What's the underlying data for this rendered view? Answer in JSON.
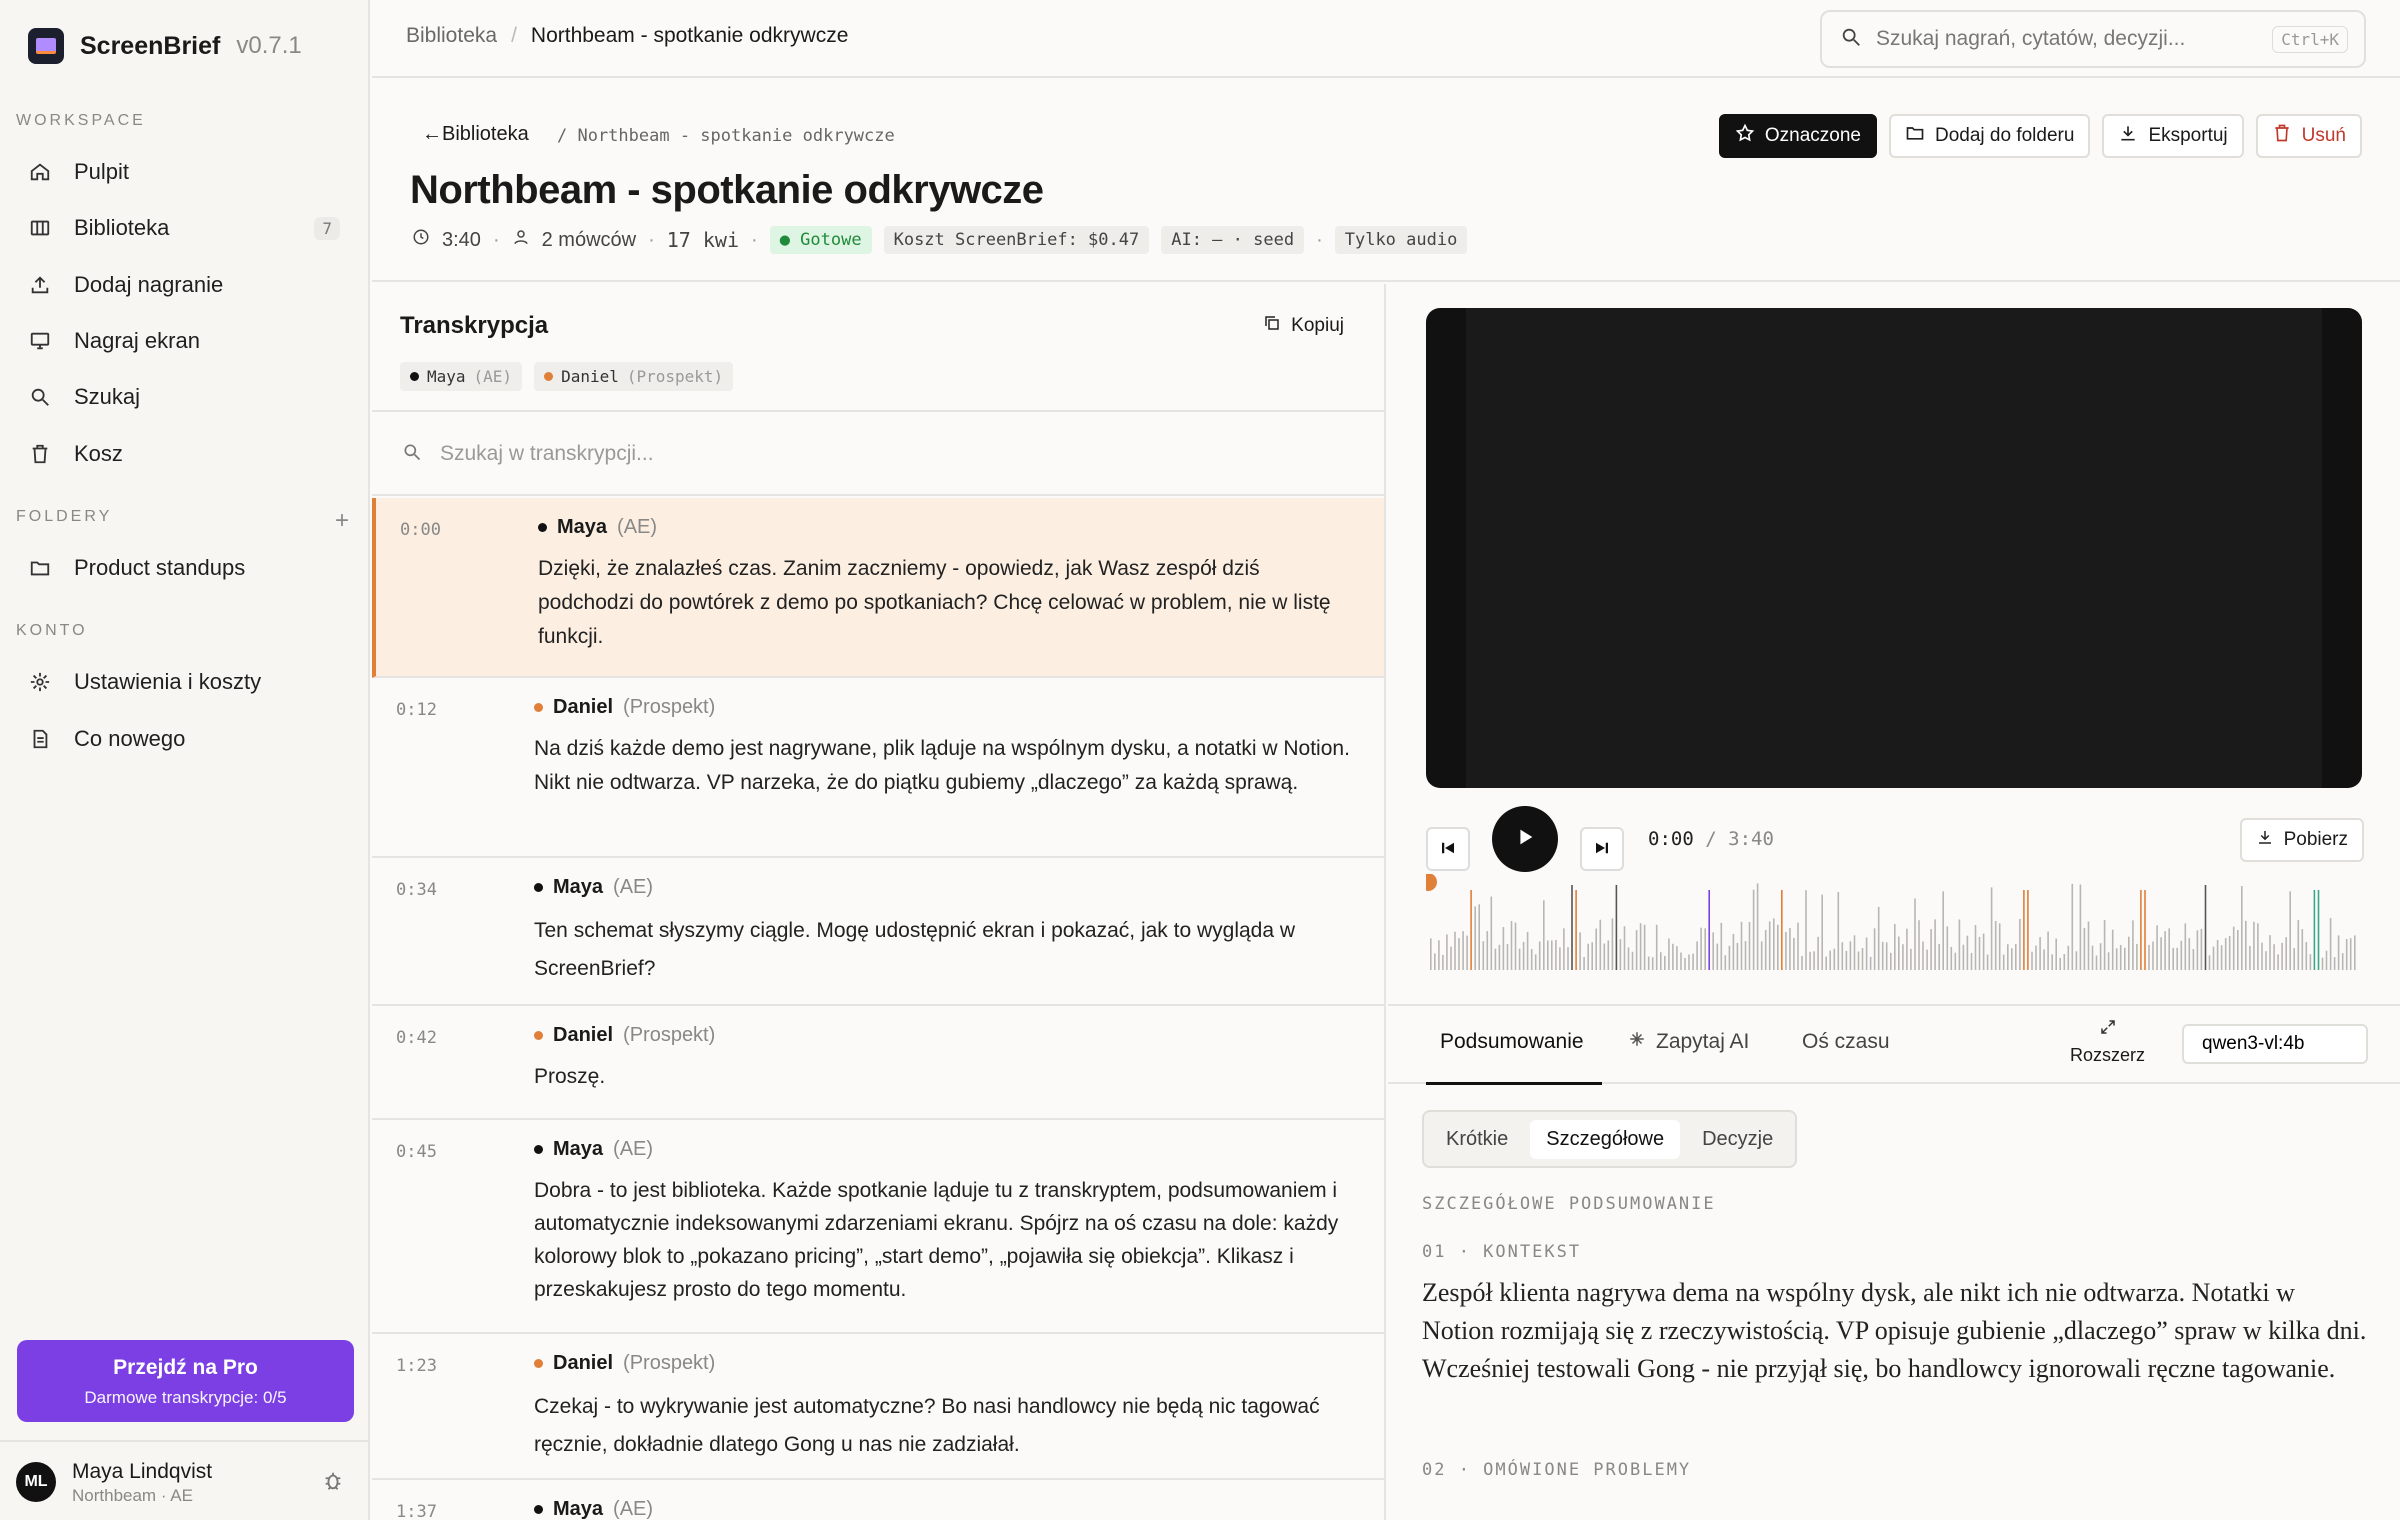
{
  "app": {
    "name": "ScreenBrief",
    "version": "v0.7.1"
  },
  "sidebar": {
    "workspace_label": "WORKSPACE",
    "workspace_items": [
      {
        "label": "Pulpit",
        "icon": "home-icon"
      },
      {
        "label": "Biblioteka",
        "icon": "library-icon",
        "badge": "7"
      },
      {
        "label": "Dodaj nagranie",
        "icon": "upload-icon"
      },
      {
        "label": "Nagraj ekran",
        "icon": "monitor-icon"
      },
      {
        "label": "Szukaj",
        "icon": "search-icon"
      },
      {
        "label": "Kosz",
        "icon": "trash-icon"
      }
    ],
    "folders_label": "FOLDERY",
    "folders": [
      {
        "label": "Product standups",
        "icon": "folder-icon"
      }
    ],
    "account_label": "KONTO",
    "account_items": [
      {
        "label": "Ustawienia i koszty",
        "icon": "settings-icon"
      },
      {
        "label": "Co nowego",
        "icon": "document-icon"
      }
    ],
    "pro": {
      "title": "Przejdź na Pro",
      "subtitle": "Darmowe transkrypcje: 0/5"
    },
    "user": {
      "initials": "ML",
      "name": "Maya Lindqvist",
      "sub": "Northbeam · AE"
    }
  },
  "topbar": {
    "crumb_root": "Biblioteka",
    "crumb_sep": "/",
    "crumb_current": "Northbeam - spotkanie odkrywcze",
    "search_placeholder": "Szukaj nagrań, cytatów, decyzji...",
    "search_shortcut": "Ctrl+K"
  },
  "header": {
    "back_label": "←Biblioteka",
    "sub_crumb": "/  Northbeam - spotkanie odkrywcze",
    "title": "Northbeam - spotkanie odkrywcze",
    "duration": "3:40",
    "speakers": "2 mówców",
    "date": "17 kwi",
    "status": "Gotowe",
    "cost": "Koszt ScreenBrief: $0.47",
    "ai": "AI: – · seed",
    "mode": "Tylko audio",
    "buttons": {
      "marked": "Oznaczone",
      "add_folder": "Dodaj do folderu",
      "export": "Eksportuj",
      "delete": "Usuń"
    }
  },
  "transcript": {
    "title": "Transkrypcja",
    "copy_label": "Kopiuj",
    "speakers": [
      {
        "name": "Maya",
        "role": "(AE)",
        "color": "#111111"
      },
      {
        "name": "Daniel",
        "role": "(Prospekt)",
        "color": "#e07f38"
      }
    ],
    "search_placeholder": "Szukaj w transkrypcji...",
    "segments": [
      {
        "ts": "0:00",
        "name": "Maya",
        "role": "(AE)",
        "color": "black",
        "text": "Dzięki, że znalazłeś czas. Zanim zaczniemy - opowiedz, jak Wasz zespół dziś podchodzi do powtórek z demo po spotkaniach? Chcę celować w problem, nie w listę funkcji."
      },
      {
        "ts": "0:12",
        "name": "Daniel",
        "role": "(Prospekt)",
        "color": "orange",
        "text": "Na dziś każde demo jest nagrywane, plik ląduje na wspólnym dysku, a notatki w Notion. Nikt nie odtwarza. VP narzeka, że do piątku gubiemy „dlaczego” za każdą sprawą."
      },
      {
        "ts": "0:34",
        "name": "Maya",
        "role": "(AE)",
        "color": "black",
        "text": "Ten schemat słyszymy ciągle. Mogę udostępnić ekran i pokazać, jak to wygląda w ScreenBrief?"
      },
      {
        "ts": "0:42",
        "name": "Daniel",
        "role": "(Prospekt)",
        "color": "orange",
        "text": "Proszę."
      },
      {
        "ts": "0:45",
        "name": "Maya",
        "role": "(AE)",
        "color": "black",
        "text": "Dobra - to jest biblioteka. Każde spotkanie ląduje tu z transkryptem, podsumowaniem i automatycznie indeksowanymi zdarzeniami ekranu. Spójrz na oś czasu na dole: każdy kolorowy blok to „pokazano pricing”, „start demo”, „pojawiła się obiekcja”. Klikasz i przeskakujesz prosto do tego momentu."
      },
      {
        "ts": "1:23",
        "name": "Daniel",
        "role": "(Prospekt)",
        "color": "orange",
        "text": "Czekaj - to wykrywanie jest automatyczne? Bo nasi handlowcy nie będą nic tagować ręcznie, dokładnie dlatego Gong u nas nie zadziałał."
      },
      {
        "ts": "1:37",
        "name": "Maya",
        "role": "(AE)",
        "color": "black",
        "text": ""
      }
    ]
  },
  "player": {
    "current": "0:00",
    "sep": "/",
    "total": "3:40",
    "download_label": "Pobierz",
    "progress": 0
  },
  "panel": {
    "tabs": [
      {
        "label": "Podsumowanie"
      },
      {
        "label": "Zapytaj AI"
      },
      {
        "label": "Oś czasu"
      }
    ],
    "expand_label": "Rozszerz",
    "model": "qwen3-vl:4b",
    "modes": [
      "Krótkie",
      "Szczegółowe",
      "Decyzje"
    ],
    "section_title": "SZCZEGÓŁOWE PODSUMOWANIE",
    "s1_label": "01 · KONTEKST",
    "s1_text": "Zespół klienta nagrywa dema na wspólny dysk, ale nikt ich nie odtwarza. Notatki w Notion rozmijają się z rzeczywistością. VP opisuje gubienie „dlaczego” spraw w kilka dni. Wcześniej testowali Gong - nie przyjął się, bo handlowcy ignorowali ręczne tagowanie.",
    "s2_label": "02 · OMÓWIONE PROBLEMY"
  },
  "colors": {
    "accent": "#7b3fe4",
    "speaker_a": "#111111",
    "speaker_b": "#e07f38",
    "active_row": "#fcefe2",
    "status_green": "#1f8a3a"
  }
}
